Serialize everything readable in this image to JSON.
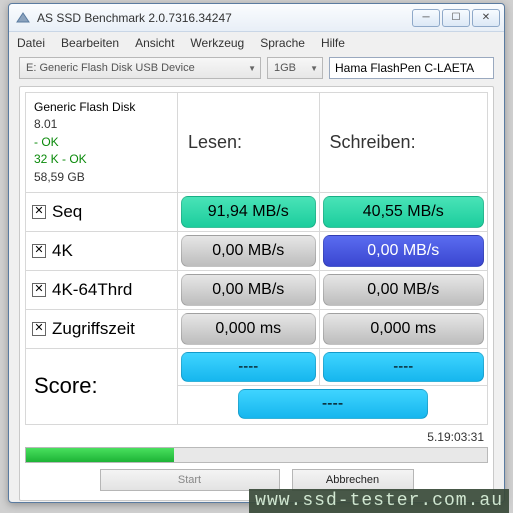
{
  "window": {
    "title": "AS SSD Benchmark 2.0.7316.34247"
  },
  "menu": {
    "file": "Datei",
    "edit": "Bearbeiten",
    "view": "Ansicht",
    "tools": "Werkzeug",
    "language": "Sprache",
    "help": "Hilfe"
  },
  "toolbar": {
    "device": "E: Generic Flash Disk USB Device",
    "size": "1GB",
    "product": "Hama FlashPen C-LAETA"
  },
  "info": {
    "name": "Generic Flash Disk",
    "version": "8.01",
    "ok1": " - OK",
    "ok2": "32 K - OK",
    "capacity": "58,59 GB"
  },
  "headers": {
    "read": "Lesen:",
    "write": "Schreiben:"
  },
  "rows": {
    "seq": {
      "label": "Seq",
      "read": "91,94 MB/s",
      "write": "40,55 MB/s"
    },
    "k4": {
      "label": "4K",
      "read": "0,00 MB/s",
      "write": "0,00 MB/s"
    },
    "k464": {
      "label": "4K-64Thrd",
      "read": "0,00 MB/s",
      "write": "0,00 MB/s"
    },
    "acc": {
      "label": "Zugriffszeit",
      "read": "0,000 ms",
      "write": "0,000 ms"
    }
  },
  "score": {
    "label": "Score:",
    "read": "----",
    "write": "----",
    "total": "----"
  },
  "timer": "5.19:03:31",
  "progress_pct": 32,
  "buttons": {
    "start": "Start",
    "abort": "Abbrechen"
  },
  "watermark": "www.ssd-tester.com.au"
}
